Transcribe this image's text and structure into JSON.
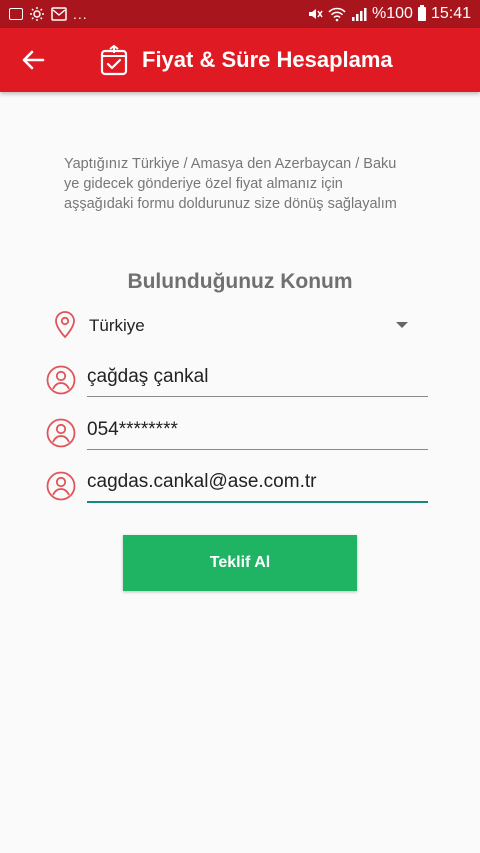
{
  "status_bar": {
    "notification_overflow": "...",
    "battery_text": "%100",
    "time": "15:41",
    "left_icons": [
      "gallery-icon",
      "brightness-icon",
      "email-icon"
    ],
    "right_icons": [
      "mute-icon",
      "wifi-icon",
      "signal-icon",
      "battery-icon"
    ]
  },
  "app_bar": {
    "title": "Fiyat & Süre Hesaplama",
    "background_color": "#e01a22",
    "back_icon": "arrow-left-icon",
    "logo_icon": "package-check-icon"
  },
  "intro_text": "Yaptığınız Türkiye / Amasya den Azerbaycan / Baku ye gidecek gönderiye özel fiyat almanız için aşşağıdaki formu doldurunuz size dönüş sağlayalım",
  "section_title": "Bulunduğunuz Konum",
  "form": {
    "country": {
      "selected": "Türkiye",
      "icon": "location-pin-icon"
    },
    "name": {
      "value": "çağdaş çankal",
      "icon": "user-icon"
    },
    "phone": {
      "value": "054********",
      "icon": "user-icon"
    },
    "email": {
      "value": "cagdas.cankal@ase.com.tr",
      "icon": "user-icon"
    }
  },
  "submit_label": "Teklif Al",
  "colors": {
    "accent_red": "#e01a22",
    "status_bar": "#a9151d",
    "button_green": "#1fb364",
    "focus_teal": "#14897e",
    "icon_red": "#e0555a"
  }
}
